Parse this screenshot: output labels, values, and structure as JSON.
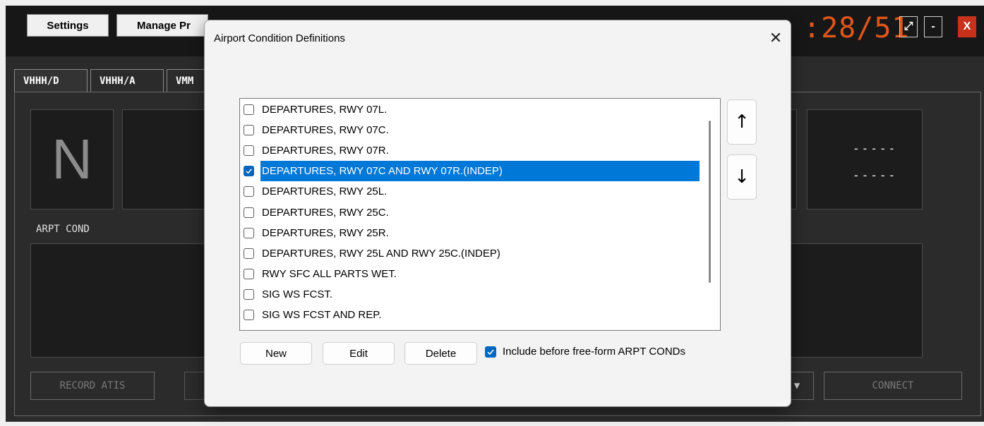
{
  "app": {
    "buttons": {
      "settings": "Settings",
      "manage": "Manage Pr"
    },
    "timer": ":28/51",
    "window": {
      "restore_icon": "⤢",
      "minimize": "-",
      "close": "X"
    },
    "tabs": [
      "VHHH/D",
      "VHHH/A",
      "VMM"
    ],
    "tile_letter": "N",
    "dashes": [
      "-----",
      "-----"
    ],
    "arpt_cond_label": "ARPT COND",
    "record_atis": "RECORD ATIS",
    "connect": "CONNECT",
    "colors": {
      "timer": "#e0561b",
      "close": "#c8321c"
    }
  },
  "dialog": {
    "title": "Airport Condition Definitions",
    "close_icon": "close-icon",
    "items": [
      {
        "label": "DEPARTURES, RWY 07L.",
        "checked": false,
        "selected": false
      },
      {
        "label": "DEPARTURES, RWY 07C.",
        "checked": false,
        "selected": false
      },
      {
        "label": "DEPARTURES, RWY 07R.",
        "checked": false,
        "selected": false
      },
      {
        "label": "DEPARTURES, RWY 07C AND RWY 07R.(INDEP)",
        "checked": true,
        "selected": true
      },
      {
        "label": "DEPARTURES, RWY 25L.",
        "checked": false,
        "selected": false
      },
      {
        "label": "DEPARTURES, RWY 25C.",
        "checked": false,
        "selected": false
      },
      {
        "label": "DEPARTURES, RWY 25R.",
        "checked": false,
        "selected": false
      },
      {
        "label": "DEPARTURES, RWY 25L AND RWY 25C.(INDEP)",
        "checked": false,
        "selected": false
      },
      {
        "label": "RWY SFC ALL PARTS WET.",
        "checked": false,
        "selected": false
      },
      {
        "label": "SIG WS FCST.",
        "checked": false,
        "selected": false
      },
      {
        "label": "SIG WS FCST AND REP.",
        "checked": false,
        "selected": false
      }
    ],
    "move_up": "↑",
    "move_down": "↓",
    "new_label": "New",
    "edit_label": "Edit",
    "delete_label": "Delete",
    "include_label": "Include before free-form ARPT CONDs",
    "include_checked": true,
    "colors": {
      "selection": "#0078d7",
      "checkbox": "#0067c0"
    }
  }
}
